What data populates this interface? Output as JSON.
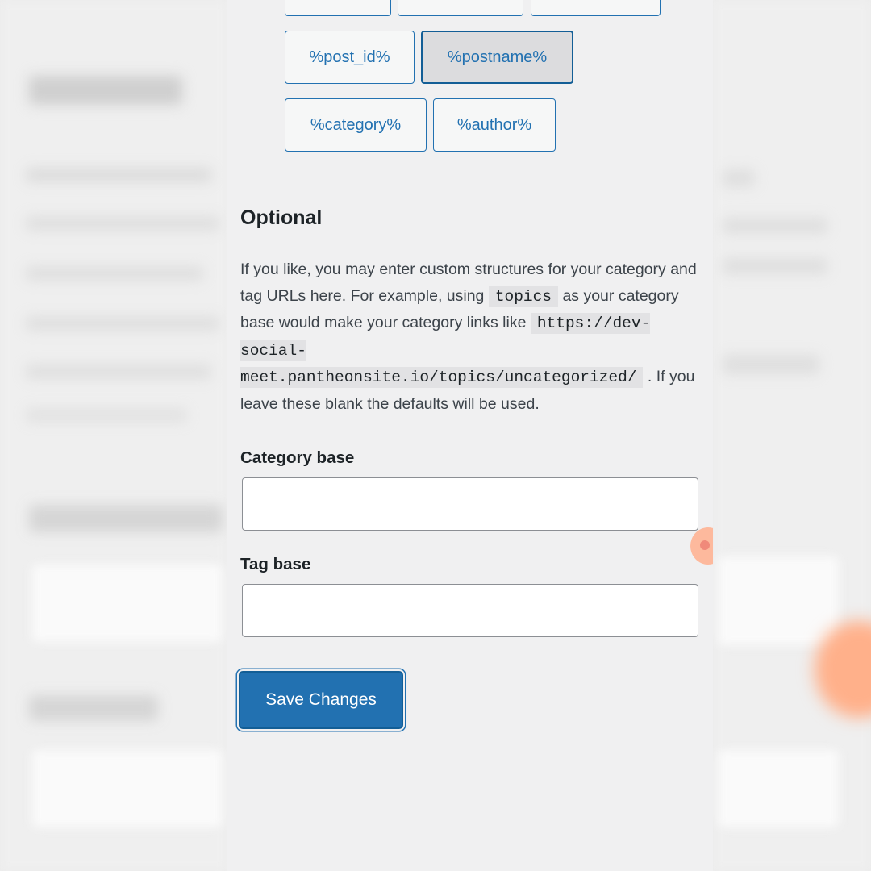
{
  "structure_tags": {
    "row_top_partial": [
      "",
      "",
      ""
    ],
    "row1": [
      "%post_id%",
      "%postname%"
    ],
    "row2": [
      "%category%",
      "%author%"
    ],
    "active": "%postname%"
  },
  "optional": {
    "heading": "Optional",
    "desc_part1": "If you like, you may enter custom structures for your category and tag URLs here. For example, using ",
    "code_topics": "topics",
    "desc_part2": " as your category base would make your category links like ",
    "code_url": "https://dev-social-meet.pantheonsite.io/topics/uncategorized/",
    "desc_part3": " . If you leave these blank the defaults will be used."
  },
  "fields": {
    "category_base_label": "Category base",
    "category_base_value": "",
    "tag_base_label": "Tag base",
    "tag_base_value": ""
  },
  "actions": {
    "save_label": "Save Changes"
  },
  "colors": {
    "accent": "#2271b1",
    "accent_dark": "#135e96",
    "text": "#1d2327",
    "background": "#f0f0f1"
  }
}
